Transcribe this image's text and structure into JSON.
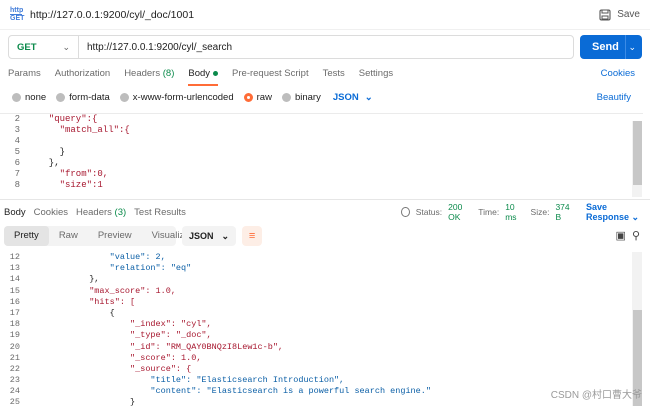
{
  "top": {
    "badge_line1": "http",
    "badge_line2": "GET",
    "title": "http://127.0.0.1:9200/cyl/_doc/1001",
    "save_label": "Save"
  },
  "request": {
    "method": "GET",
    "url": "http://127.0.0.1:9200/cyl/_search",
    "send_label": "Send"
  },
  "request_tabs": [
    {
      "label": "Params"
    },
    {
      "label": "Authorization"
    },
    {
      "label": "Headers",
      "count": "(8)"
    },
    {
      "label": "Body"
    },
    {
      "label": "Pre-request Script"
    },
    {
      "label": "Tests"
    },
    {
      "label": "Settings"
    }
  ],
  "cookies_label": "Cookies",
  "body_options": [
    "none",
    "form-data",
    "x-www-form-urlencoded",
    "raw",
    "binary"
  ],
  "body_format": "JSON",
  "beautify_label": "Beautify",
  "request_body_lines": [
    {
      "n": "2",
      "text": "  \"query\":{"
    },
    {
      "n": "3",
      "text": "    \"match_all\":{"
    },
    {
      "n": "4",
      "text": ""
    },
    {
      "n": "5",
      "text": "    }"
    },
    {
      "n": "6",
      "text": "  },"
    },
    {
      "n": "7",
      "text": "    \"from\":0,"
    },
    {
      "n": "8",
      "text": "    \"size\":1"
    }
  ],
  "response_tabs": [
    {
      "label": "Body"
    },
    {
      "label": "Cookies"
    },
    {
      "label": "Headers",
      "count": "(3)"
    },
    {
      "label": "Test Results"
    }
  ],
  "status": {
    "status_label": "Status:",
    "status_value": "200 OK",
    "time_label": "Time:",
    "time_value": "10 ms",
    "size_label": "Size:",
    "size_value": "374 B",
    "save_response_label": "Save Response"
  },
  "view_modes": [
    "Pretty",
    "Raw",
    "Preview",
    "Visualize"
  ],
  "response_format": "JSON",
  "response_lines": [
    {
      "n": "12",
      "text": "                \"value\": 2,"
    },
    {
      "n": "13",
      "text": "                \"relation\": \"eq\""
    },
    {
      "n": "14",
      "text": "            },"
    },
    {
      "n": "15",
      "text": "            \"max_score\": 1.0,"
    },
    {
      "n": "16",
      "text": "            \"hits\": ["
    },
    {
      "n": "17",
      "text": "                {"
    },
    {
      "n": "18",
      "text": "                    \"_index\": \"cyl\","
    },
    {
      "n": "19",
      "text": "                    \"_type\": \"_doc\","
    },
    {
      "n": "20",
      "text": "                    \"_id\": \"RM_QAY0BNQzI8Lew1c-b\","
    },
    {
      "n": "21",
      "text": "                    \"_score\": 1.0,"
    },
    {
      "n": "22",
      "text": "                    \"_source\": {"
    },
    {
      "n": "23",
      "text": "                        \"title\": \"Elasticsearch Introduction\","
    },
    {
      "n": "24",
      "text": "                        \"content\": \"Elasticsearch is a powerful search engine.\""
    },
    {
      "n": "25",
      "text": "                    }"
    }
  ],
  "watermark": "CSDN @村口曹大爷"
}
